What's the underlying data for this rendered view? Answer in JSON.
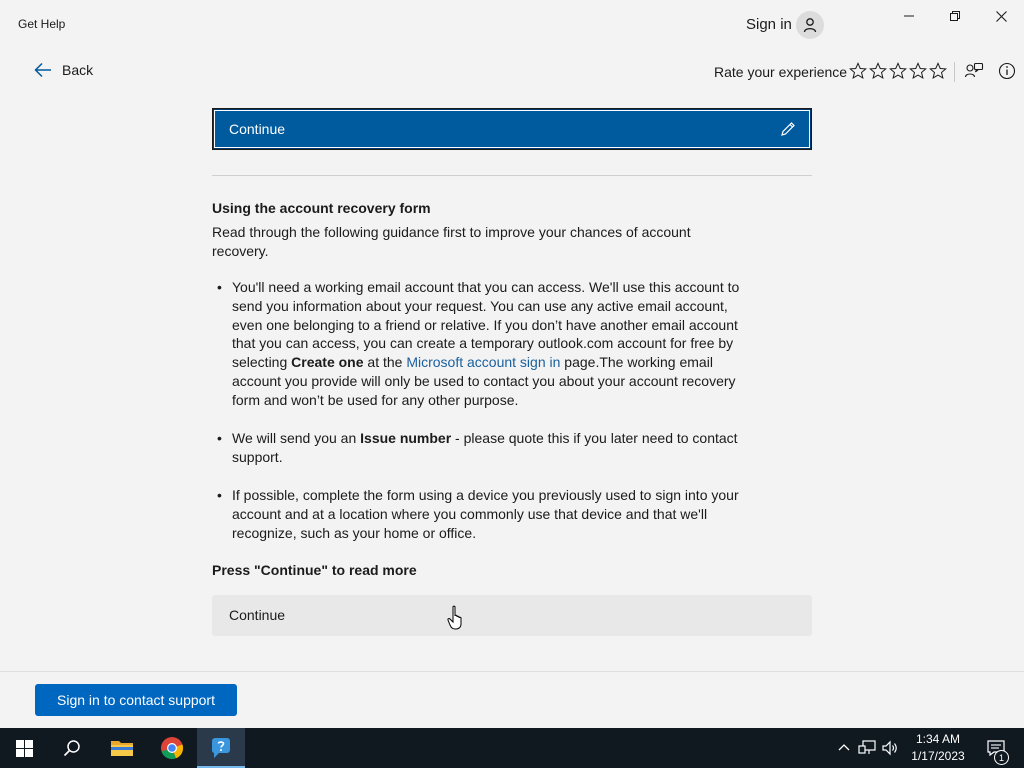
{
  "window": {
    "title": "Get Help",
    "sign_in_label": "Sign in"
  },
  "commandbar": {
    "back_label": "Back",
    "rate_label": "Rate your experience",
    "stars_total": 5,
    "stars_filled": 0
  },
  "main": {
    "selected_step": {
      "label": "Continue"
    },
    "section_heading": "Using the account recovery form",
    "intro": "Read through the following guidance first to improve your chances of account recovery.",
    "bullets": [
      {
        "p1": "You'll need a working email account that you can access. We'll use this account to send you information about your request. You can use any active email account, even one belonging to a friend or relative. If you don’t have another email account that you can access, you can create a temporary outlook.com account for free by selecting ",
        "bold": "Create one",
        "p2": " at the ",
        "link": "Microsoft account sign in",
        "p3": " page.The working email account you provide will only be used to contact you about your account recovery form and won’t be used for any other purpose."
      },
      {
        "p1": "We will send you an ",
        "bold": "Issue number",
        "p2": " - please quote this if you later need to contact support."
      },
      {
        "p1": "If possible, complete the form using a device you previously used to sign into your account and at a location where you commonly use that device and that we'll recognize, such as your home or office."
      }
    ],
    "press_prompt": "Press \"Continue\" to read more",
    "continue_button": "Continue"
  },
  "footer": {
    "support_button": "Sign in to contact support"
  },
  "taskbar": {
    "time": "1:34 AM",
    "date": "1/17/2023",
    "notification_count": "1",
    "accent": "#76b9ed"
  },
  "colors": {
    "selected_step_bg": "#005a9e",
    "primary_button": "#0067c0",
    "link": "#1a5f9e"
  }
}
